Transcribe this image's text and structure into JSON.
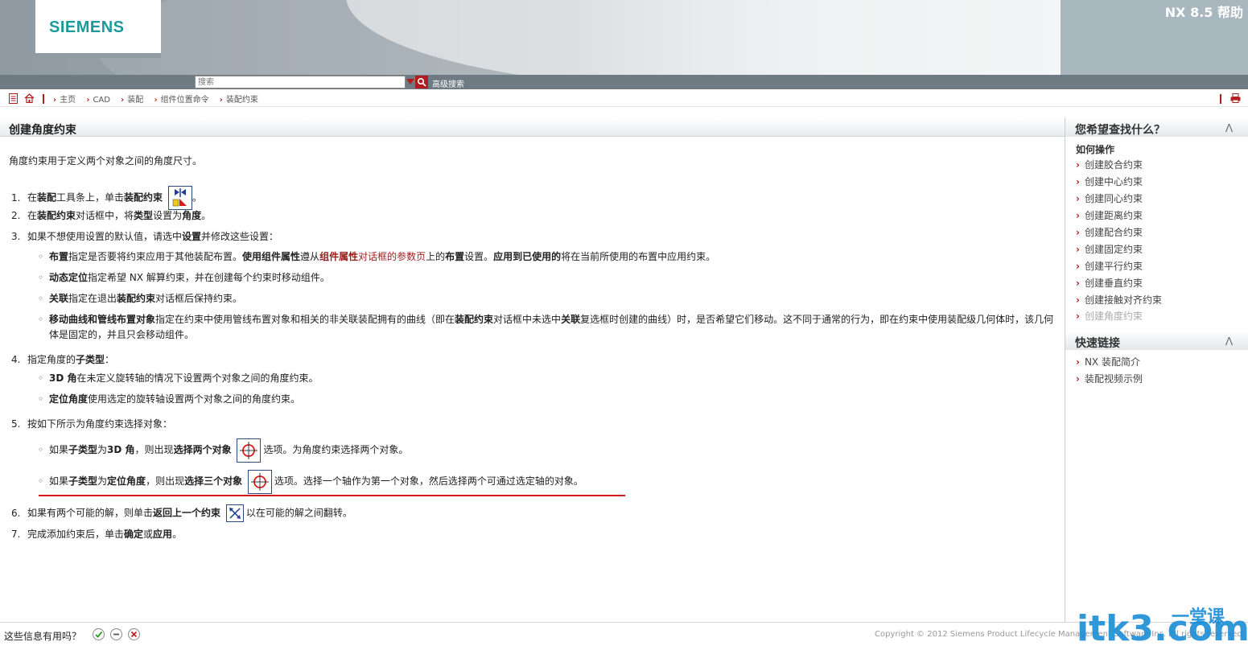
{
  "header": {
    "brand": "SIEMENS",
    "title": "NX 8.5 帮助"
  },
  "search": {
    "placeholder": "搜索",
    "advanced_label": "高级搜索"
  },
  "breadcrumb": {
    "items": [
      "主页",
      "CAD",
      "装配",
      "组件位置命令",
      "装配约束"
    ]
  },
  "content": {
    "title": "创建角度约束",
    "intro": "角度约束用于定义两个对象之间的角度尺寸。",
    "steps": [
      {
        "num": "1.",
        "t1": "在",
        "b1": "装配",
        "t2": "工具条上，单击",
        "b2": "装配约束",
        "t3": "。"
      },
      {
        "num": "2.",
        "t1": "在",
        "b1": "装配约束",
        "t2": "对话框中，将",
        "b2": "类型",
        "t3": "设置为",
        "b3": "角度",
        "t4": "。"
      },
      {
        "num": "3.",
        "t1": "如果不想使用设置的默认值，请选中",
        "b1": "设置",
        "t2": "并修改这些设置："
      },
      {
        "num": "4.",
        "t1": "指定角度的",
        "b1": "子类型",
        "t2": "："
      },
      {
        "num": "5.",
        "t1": "按如下所示为角度约束选择对象："
      },
      {
        "num": "6.",
        "t1": "如果有两个可能的解，则单击",
        "b1": "返回上一个约束",
        "t2": "以在可能的解之间翻转。"
      },
      {
        "num": "7.",
        "t1": "完成添加约束后，单击",
        "b1": "确定",
        "t2": "或",
        "b2": "应用",
        "t3": "。"
      }
    ],
    "settings": [
      {
        "b1": "布置",
        "t1": "指定是否要将约束应用于其他装配布置。",
        "b2": "使用组件属性",
        "t2": "遵从",
        "l1": "组件属性",
        "l2": "对话框的参数页",
        "t3": "上的",
        "b3": "布置",
        "t4": "设置。",
        "b4": "应用到已使用的",
        "t5": "将在当前所使用的布置中应用约束。"
      },
      {
        "b1": "动态定位",
        "t1": "指定希望 NX 解算约束，并在创建每个约束时移动组件。"
      },
      {
        "b1": "关联",
        "t1": "指定在退出",
        "b2": "装配约束",
        "t2": "对话框后保持约束。"
      },
      {
        "b1": "移动曲线和管线布置对象",
        "t1": "指定在约束中使用管线布置对象和相关的非关联装配拥有的曲线（即在",
        "b2": "装配约束",
        "t2": "对话框中未选中",
        "b3": "关联",
        "t3": "复选框时创建的曲线）时，是否希望它们移动。这不同于通常的行为，即在约束中使用装配级几何体时，该几何体是固定的，并且只会移动组件。"
      }
    ],
    "subtypes": [
      {
        "b1": "3D 角",
        "t1": "在未定义旋转轴的情况下设置两个对象之间的角度约束。"
      },
      {
        "b1": "定位角度",
        "t1": "使用选定的旋转轴设置两个对象之间的角度约束。"
      }
    ],
    "selections": [
      {
        "t1": "如果",
        "b1": "子类型",
        "t2": "为",
        "b2": "3D 角",
        "t3": "，则出现",
        "b3": "选择两个对象",
        "t4": "选项。为角度约束选择两个对象。"
      },
      {
        "t1": "如果",
        "b1": "子类型",
        "t2": "为",
        "b2": "定位角度",
        "t3": "，则出现",
        "b3": "选择三个对象",
        "t4": "选项。选择一个轴作为第一个对象，然后选择两个可通过选定轴的对象。"
      }
    ]
  },
  "sidebar": {
    "find_title": "您希望查找什么？",
    "howto_title": "如何操作",
    "howto_links": [
      "创建胶合约束",
      "创建中心约束",
      "创建同心约束",
      "创建距离约束",
      "创建配合约束",
      "创建固定约束",
      "创建平行约束",
      "创建垂直约束",
      "创建接触对齐约束",
      "创建角度约束"
    ],
    "quick_title": "快速链接",
    "quick_links": [
      "NX 装配简介",
      "装配视频示例"
    ]
  },
  "footer": {
    "feedback_question": "这些信息有用吗？",
    "copyright": "Copyright © 2012 Siemens Product Lifecycle Management Software Inc. All rights reserved."
  },
  "watermark": "itk3.com",
  "watermark_cn": "一堂课",
  "colors": {
    "accent_red": "#b21e1e",
    "brand_teal": "#1c9a9b",
    "link_red": "#9b1c1c"
  }
}
